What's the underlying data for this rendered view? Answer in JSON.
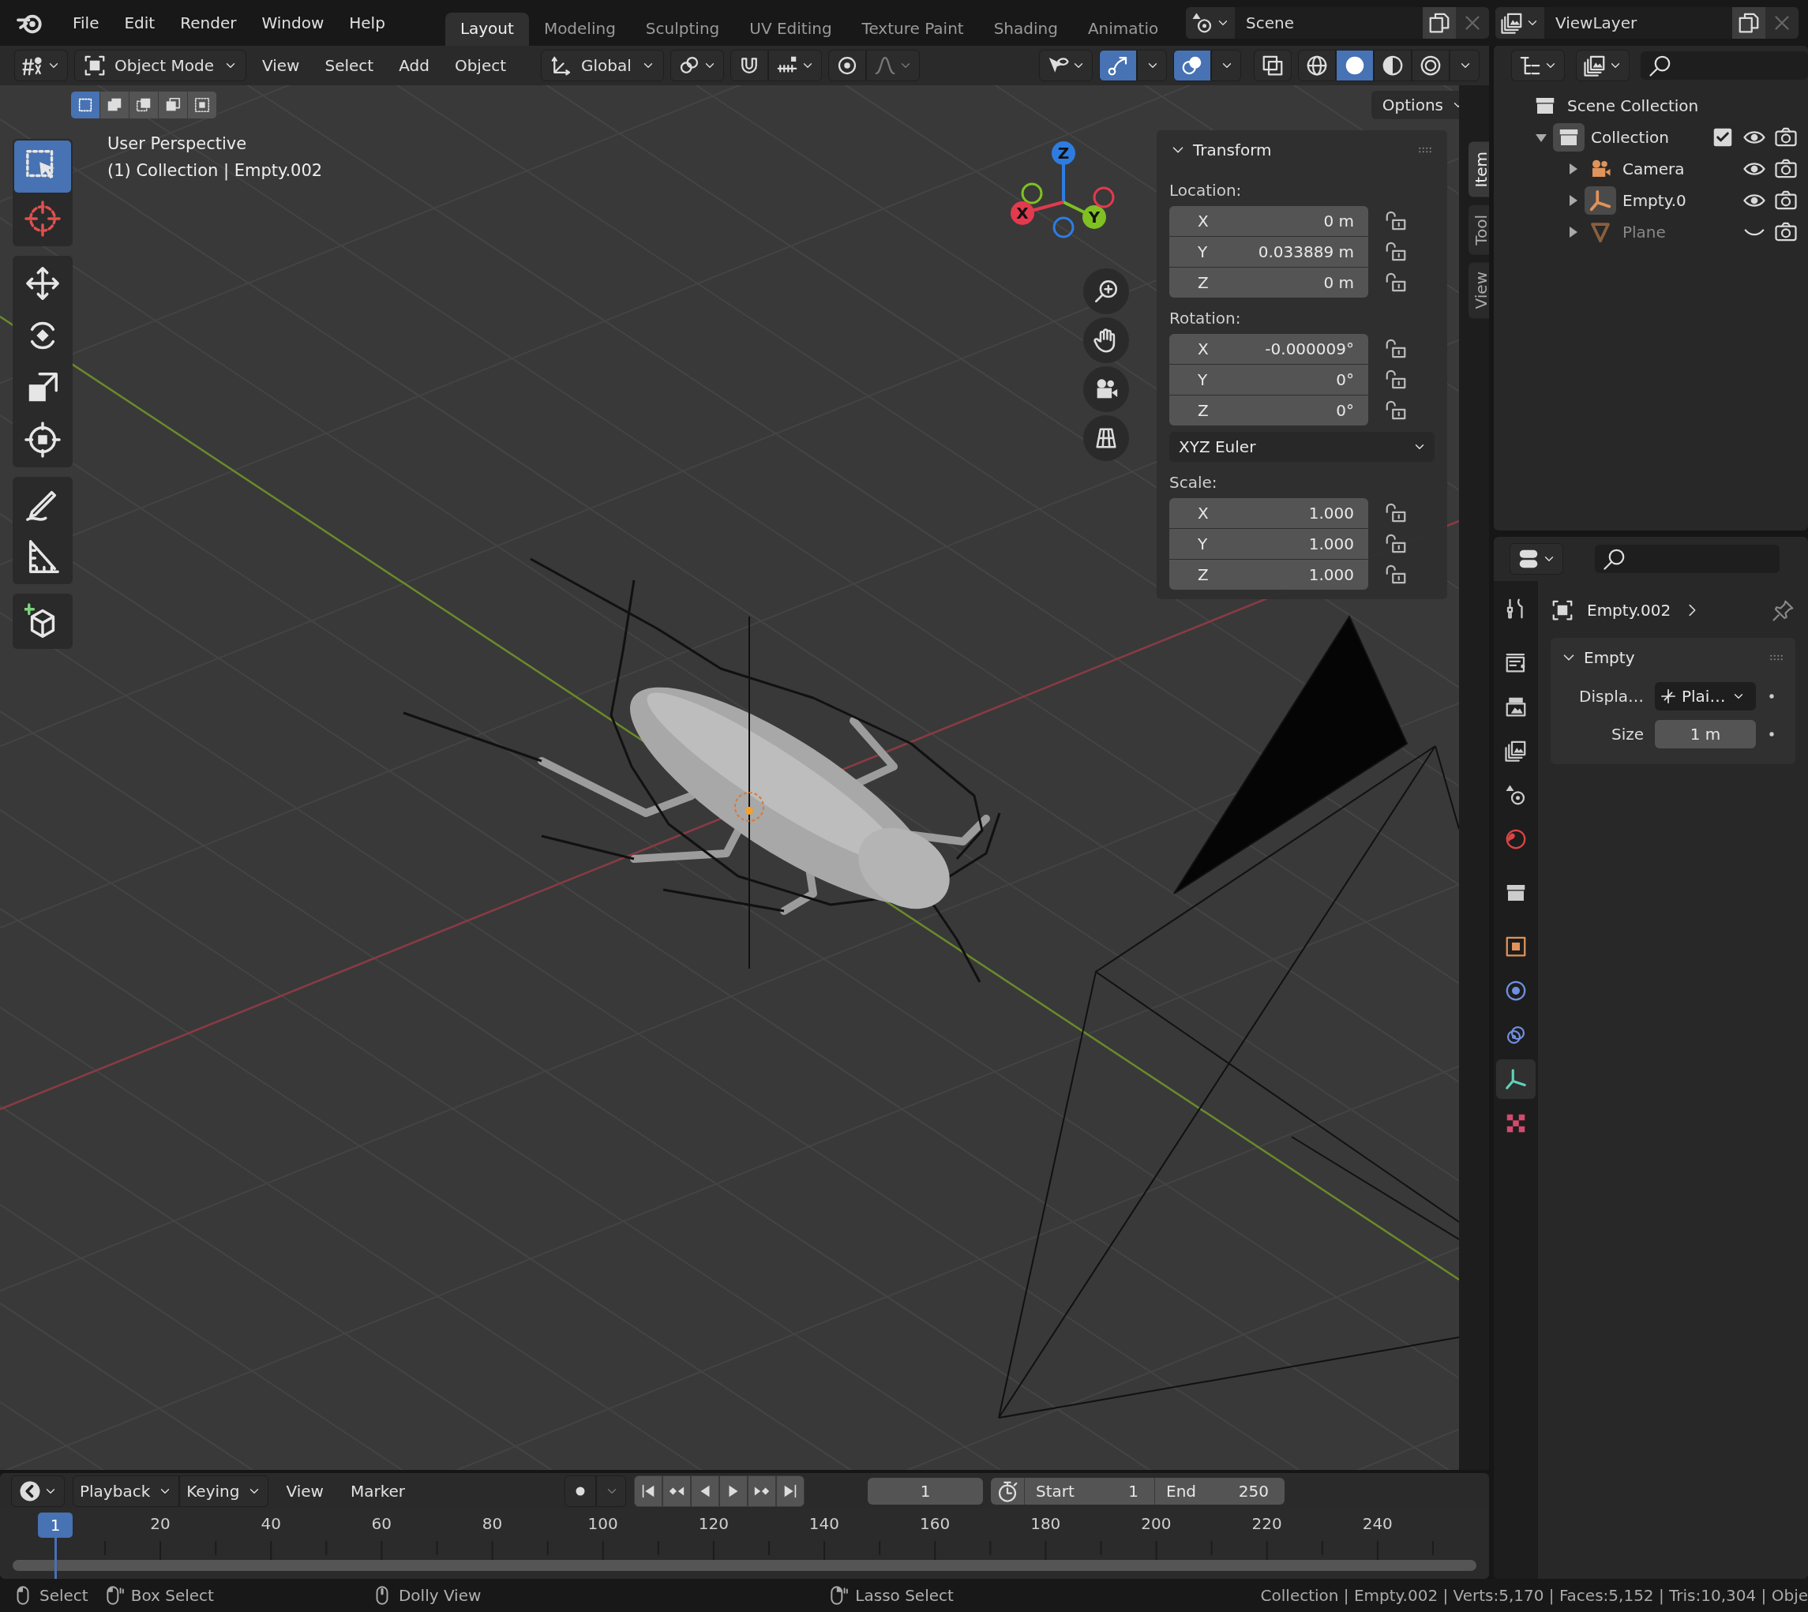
{
  "menu_bar": {
    "menus": [
      "File",
      "Edit",
      "Render",
      "Window",
      "Help"
    ]
  },
  "workspaces": [
    {
      "label": "Layout",
      "selected": true
    },
    {
      "label": "Modeling",
      "selected": false
    },
    {
      "label": "Sculpting",
      "selected": false
    },
    {
      "label": "UV Editing",
      "selected": false
    },
    {
      "label": "Texture Paint",
      "selected": false
    },
    {
      "label": "Shading",
      "selected": false
    },
    {
      "label": "Animatio",
      "selected": false
    }
  ],
  "scene": {
    "name": "Scene"
  },
  "view_layer": {
    "name": "ViewLayer"
  },
  "viewport_header": {
    "mode": "Object Mode",
    "menus": [
      "View",
      "Select",
      "Add",
      "Object"
    ],
    "orientation": "Global",
    "snap": {
      "on": false
    },
    "proportional_editing": {
      "on": false
    },
    "toggles": [
      {
        "kind": "visibility",
        "on": false
      },
      {
        "kind": "gizmo",
        "on": true
      },
      {
        "kind": "overlay",
        "on": true
      },
      {
        "kind": "xray",
        "on": false
      }
    ],
    "shading": [
      {
        "kind": "wireframe",
        "selected": false
      },
      {
        "kind": "solid",
        "selected": true
      },
      {
        "kind": "material",
        "selected": false
      },
      {
        "kind": "rendered",
        "selected": false
      }
    ]
  },
  "tool_header": {
    "select_modes": [
      {
        "kind": "set",
        "selected": true
      },
      {
        "kind": "extend",
        "selected": false
      },
      {
        "kind": "subtract",
        "selected": false
      },
      {
        "kind": "invert",
        "selected": false
      },
      {
        "kind": "intersect",
        "selected": false
      }
    ],
    "options": "Options"
  },
  "toolbar": {
    "groups": [
      {
        "tools": [
          {
            "kind": "select",
            "selected": true
          },
          {
            "kind": "cursor",
            "selected": false
          }
        ]
      },
      {
        "tools": [
          {
            "kind": "move",
            "selected": false
          },
          {
            "kind": "rotate",
            "selected": false
          },
          {
            "kind": "scale",
            "selected": false
          },
          {
            "kind": "transform",
            "selected": false
          }
        ]
      },
      {
        "tools": [
          {
            "kind": "annotate",
            "selected": false
          },
          {
            "kind": "measure",
            "selected": false
          }
        ]
      },
      {
        "tools": [
          {
            "kind": "add-cube",
            "selected": false
          }
        ]
      }
    ]
  },
  "viewport": {
    "info": [
      "User Perspective",
      "(1) Collection | Empty.002"
    ],
    "gizmo_axes": [
      {
        "kind": "z",
        "label": "Z"
      },
      {
        "kind": "y",
        "label": "Y"
      },
      {
        "kind": "x",
        "label": "X"
      }
    ],
    "nav_buttons": [
      {
        "kind": "zoom"
      },
      {
        "kind": "pan"
      },
      {
        "kind": "camera"
      },
      {
        "kind": "ortho"
      }
    ]
  },
  "transform": {
    "title": "Transform",
    "sections": [
      {
        "label": "Location:",
        "fields": [
          {
            "axis": "X",
            "value": "0 m",
            "locked": false
          },
          {
            "axis": "Y",
            "value": "0.033889 m",
            "locked": false
          },
          {
            "axis": "Z",
            "value": "0 m",
            "locked": false
          }
        ]
      },
      {
        "label": "Rotation:",
        "fields": [
          {
            "axis": "X",
            "value": "-0.000009°",
            "locked": false
          },
          {
            "axis": "Y",
            "value": "0°",
            "locked": false
          },
          {
            "axis": "Z",
            "value": "0°",
            "locked": false
          }
        ],
        "mode": "XYZ Euler"
      },
      {
        "label": "Scale:",
        "fields": [
          {
            "axis": "X",
            "value": "1.000",
            "locked": false
          },
          {
            "axis": "Y",
            "value": "1.000",
            "locked": false
          },
          {
            "axis": "Z",
            "value": "1.000",
            "locked": false
          }
        ]
      }
    ]
  },
  "sidebar_tabs": [
    {
      "label": "Item",
      "selected": true
    },
    {
      "label": "Tool",
      "selected": false
    },
    {
      "label": "View",
      "selected": false
    }
  ],
  "outliner": {
    "items": [
      {
        "label": "Scene Collection",
        "kind": "scene-collection",
        "children": [
          {
            "label": "Collection",
            "kind": "collection",
            "expanded": true,
            "active": true,
            "checked": true,
            "visible": true,
            "renderable": true,
            "children": [
              {
                "label": "Camera",
                "kind": "camera",
                "expanded": false,
                "active": false,
                "visible": true,
                "renderable": true
              },
              {
                "label": "Empty.0",
                "kind": "empty",
                "expanded": false,
                "active": true,
                "visible": true,
                "renderable": true
              },
              {
                "label": "Plane",
                "kind": "mesh",
                "expanded": false,
                "active": false,
                "visible": false,
                "renderable": true
              }
            ]
          }
        ]
      }
    ]
  },
  "properties": {
    "tabs": [
      {
        "kind": "tool",
        "selected": false
      },
      {
        "kind": "render",
        "selected": false
      },
      {
        "kind": "output",
        "selected": false
      },
      {
        "kind": "view-layer",
        "selected": false
      },
      {
        "kind": "scene",
        "selected": false
      },
      {
        "kind": "world",
        "selected": false
      },
      {
        "kind": "collection",
        "selected": false
      },
      {
        "kind": "object",
        "selected": false
      },
      {
        "kind": "physics",
        "selected": false
      },
      {
        "kind": "constraints",
        "selected": false
      },
      {
        "kind": "data",
        "selected": true
      },
      {
        "kind": "texture",
        "selected": false
      }
    ],
    "object": "Empty.002",
    "panel": {
      "title": "Empty",
      "expanded": true,
      "rows": [
        {
          "kind": "dropdown",
          "label": "Displa…",
          "value": "Plai…"
        },
        {
          "kind": "number",
          "label": "Size",
          "value": "1 m"
        }
      ]
    }
  },
  "timeline": {
    "menus": [
      "Playback",
      "Keying",
      "View",
      "Marker"
    ],
    "auto_keying": {
      "on": false
    },
    "current_frame": "1",
    "start": {
      "label": "Start",
      "value": "1"
    },
    "end": {
      "label": "End",
      "value": "250"
    },
    "playhead": "1",
    "ruler_labels": [
      "20",
      "40",
      "60",
      "80",
      "100",
      "120",
      "140",
      "160",
      "180",
      "200",
      "220",
      "240"
    ]
  },
  "status_bar": {
    "hints": [
      {
        "kind": "left",
        "label": "Select"
      },
      {
        "kind": "left-drag",
        "label": "Box Select"
      },
      {
        "kind": "middle",
        "label": "Dolly View"
      },
      {
        "kind": "right-drag",
        "label": "Lasso Select"
      }
    ],
    "stats": "Collection | Empty.002 | Verts:5,170 | Faces:5,152 | Tris:10,304 | Obje"
  }
}
